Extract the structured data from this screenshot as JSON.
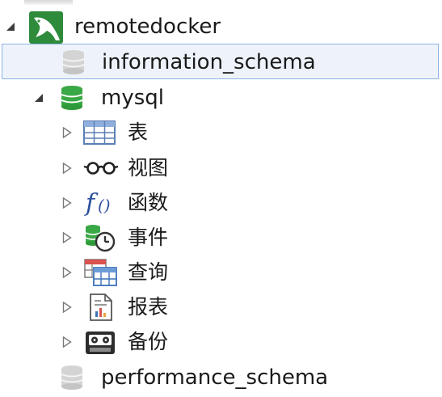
{
  "tree": {
    "connection": {
      "label": "remotedocker",
      "expanded": true,
      "icon": "mysql-dolphin-icon",
      "databases": [
        {
          "label": "information_schema",
          "selected": true,
          "open": false
        },
        {
          "label": "mysql",
          "selected": false,
          "open": true,
          "children": [
            {
              "label": "表",
              "icon": "table-icon"
            },
            {
              "label": "视图",
              "icon": "view-glasses-icon"
            },
            {
              "label": "函数",
              "icon": "function-icon"
            },
            {
              "label": "事件",
              "icon": "event-clock-icon"
            },
            {
              "label": "查询",
              "icon": "query-icon"
            },
            {
              "label": "报表",
              "icon": "report-icon"
            },
            {
              "label": "备份",
              "icon": "backup-icon"
            }
          ]
        },
        {
          "label": "performance_schema",
          "selected": false,
          "open": false
        }
      ]
    }
  },
  "colors": {
    "selection_bg": "#eef3fb",
    "selection_border": "#8fb4e6",
    "db_open_green": "#3aa845",
    "db_closed_gray": "#c8c8c8",
    "dolphin_bg": "#2e8b3c"
  }
}
